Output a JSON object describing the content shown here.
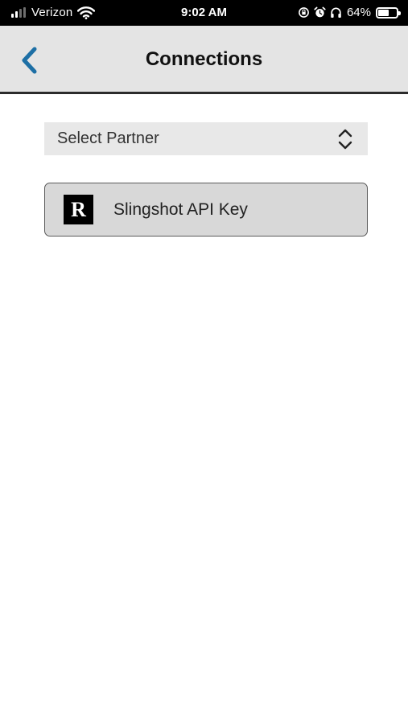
{
  "status_bar": {
    "carrier": "Verizon",
    "time": "9:02 AM",
    "battery_percent": "64%",
    "battery_level": 0.64,
    "signal_bars_filled": 2,
    "signal_bars_total": 4,
    "icons": [
      "signal-icon",
      "wifi-icon",
      "orientation-lock-icon",
      "alarm-icon",
      "headphones-icon",
      "battery-icon"
    ]
  },
  "nav": {
    "title": "Connections",
    "back_icon": "chevron-left-icon"
  },
  "select": {
    "label": "Select Partner",
    "icon": "chevron-up-down-icon"
  },
  "partners": [
    {
      "logo_letter": "R",
      "label": "Slingshot API Key"
    }
  ],
  "colors": {
    "accent": "#1d6fa5",
    "nav_background": "#e4e4e4",
    "select_background": "#e8e8e8",
    "card_background": "#d8d8d8",
    "card_border": "#5a5a5a",
    "status_bar_background": "#000000"
  }
}
